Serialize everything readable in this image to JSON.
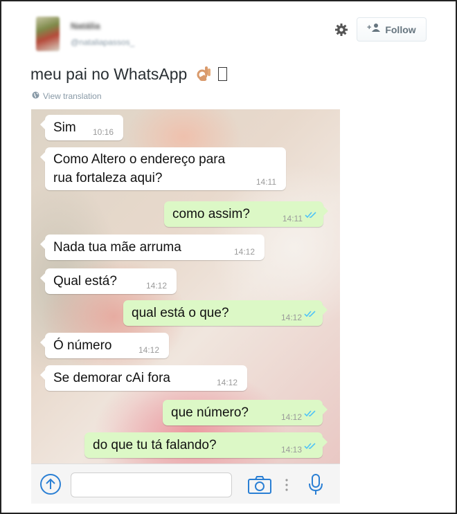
{
  "tweet": {
    "user_name": "Natália",
    "user_handle": "@nataliapassos_",
    "follow_label": "Follow",
    "text": "meu pai no WhatsApp",
    "view_translation": "View translation"
  },
  "chat": {
    "messages": [
      {
        "dir": "in",
        "text": "Sim",
        "time": "10:16"
      },
      {
        "dir": "in",
        "text": "Como Altero o endereço para",
        "text2": "rua fortaleza aqui?",
        "time": "14:11"
      },
      {
        "dir": "out",
        "text": "como assim?",
        "time": "14:11"
      },
      {
        "dir": "in",
        "text": "Nada tua mãe arruma",
        "time": "14:12"
      },
      {
        "dir": "in",
        "text": "Qual está?",
        "time": "14:12"
      },
      {
        "dir": "out",
        "text": "qual está o que?",
        "time": "14:12"
      },
      {
        "dir": "in",
        "text": "Ó número",
        "time": "14:12"
      },
      {
        "dir": "in",
        "text": "Se demorar cAi fora",
        "time": "14:12"
      },
      {
        "dir": "out",
        "text": "que número?",
        "time": "14:12"
      },
      {
        "dir": "out",
        "text": "do que tu tá falando?",
        "time": "14:13"
      }
    ]
  },
  "colors": {
    "outgoing_bubble": "#dcf8c6",
    "incoming_bubble": "#ffffff",
    "read_ticks": "#4fc3f7",
    "ui_icon_blue": "#2a7fd4"
  },
  "icons": [
    "gear-icon",
    "add-user-icon",
    "globe-icon",
    "ok-hand-emoji",
    "upload-icon",
    "camera-icon",
    "more-vertical-icon",
    "microphone-icon",
    "double-check-icon"
  ]
}
